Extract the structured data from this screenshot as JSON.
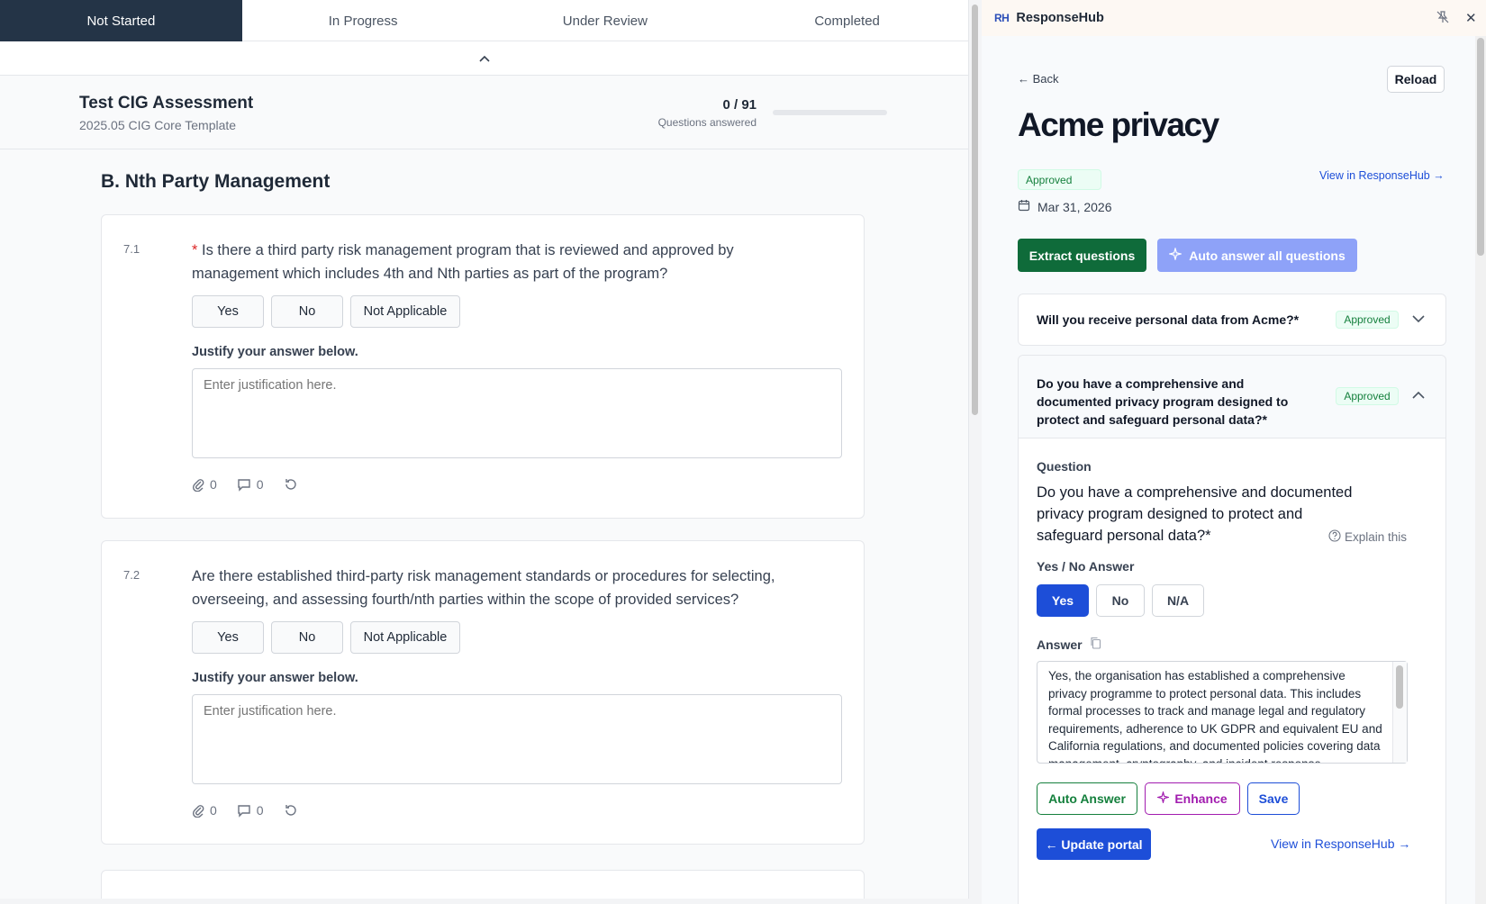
{
  "tabs": [
    "Not Started",
    "In Progress",
    "Under Review",
    "Completed"
  ],
  "assessment": {
    "title": "Test CIG Assessment",
    "subtitle": "2025.05 CIG Core Template",
    "progress_count": "0 / 91",
    "progress_label": "Questions answered",
    "progress_fraction": 0
  },
  "section_title": "B. Nth Party Management",
  "questions": [
    {
      "number": "7.1",
      "required_mark": "*",
      "text": "Is there a third party risk management program that is reviewed and approved by management which includes 4th and Nth parties as part of the program?",
      "options": [
        "Yes",
        "No",
        "Not Applicable"
      ],
      "justify_label": "Justify your answer below.",
      "justify_placeholder": "Enter justification here.",
      "attachments": "0",
      "comments": "0"
    },
    {
      "number": "7.2",
      "required_mark": "",
      "text": "Are there established third-party risk management standards or procedures for selecting, overseeing, and assessing fourth/nth parties within the scope of provided services?",
      "options": [
        "Yes",
        "No",
        "Not Applicable"
      ],
      "justify_label": "Justify your answer below.",
      "justify_placeholder": "Enter justification here.",
      "attachments": "0",
      "comments": "0"
    }
  ],
  "responsehub": {
    "logo": "RH",
    "app_name": "ResponseHub",
    "close_glyph": "✕",
    "back_label": "← Back",
    "reload_label": "Reload",
    "title": "Acme privacy",
    "status": "Approved",
    "view_link": "View in ResponseHub →",
    "date": "Mar 31, 2026",
    "extract_label": "Extract questions",
    "auto_all_label": "Auto answer all questions",
    "collapsed_item": {
      "question": "Will you receive personal data from Acme?*",
      "badge": "Approved"
    },
    "expanded_item": {
      "question": "Do you have a comprehensive and documented privacy program designed to protect and safeguard personal data?*",
      "badge": "Approved",
      "question_label": "Question",
      "question_full": "Do you have a comprehensive and documented privacy program designed to protect and safeguard personal data?*",
      "explain_label": "Explain this",
      "yn_label": "Yes / No Answer",
      "yn_options": [
        "Yes",
        "No",
        "N/A"
      ],
      "yn_selected": "Yes",
      "answer_label": "Answer",
      "answer_text": "Yes, the organisation has established a comprehensive privacy programme to protect personal data. This includes formal processes to track and manage legal and regulatory requirements, adherence to UK GDPR and equivalent EU and California regulations, and documented policies covering data management, cryptography, and incident response.",
      "auto_answer_label": "Auto Answer",
      "enhance_label": "Enhance",
      "save_label": "Save",
      "update_label": "← Update portal",
      "view_link": "View in ResponseHub →"
    }
  },
  "colors": {
    "active_tab": "#243447",
    "primary_blue": "#1d4ed8",
    "extract_green": "#0f6b3a",
    "approved_green": "#15803d",
    "auto_all_bg": "#8ea2f8",
    "enhance_purple": "#a21caf"
  }
}
